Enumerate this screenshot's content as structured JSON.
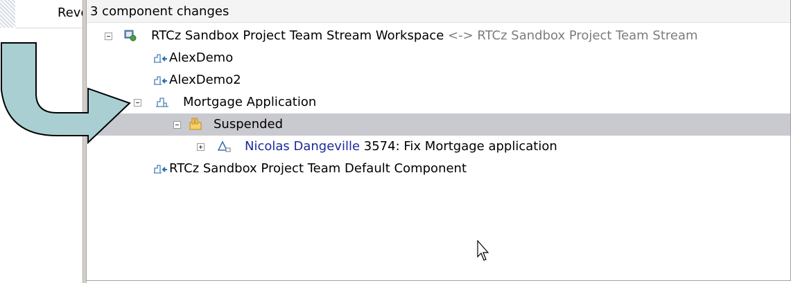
{
  "left_tab": {
    "label": "Revers"
  },
  "view": {
    "header": "3 component changes"
  },
  "tree": {
    "workspace": {
      "name": "RTCz Sandbox Project Team Stream Workspace",
      "separator": "<->",
      "target": "RTCz Sandbox Project Team Stream"
    },
    "components": [
      {
        "label": "AlexDemo"
      },
      {
        "label": "AlexDemo2"
      },
      {
        "label": "Mortgage Application"
      },
      {
        "label": "RTCz Sandbox Project Team Default Component"
      }
    ],
    "suspended": {
      "label": "Suspended"
    },
    "change_set": {
      "author": "Nicolas Dangeville",
      "description": "3574: Fix Mortgage application"
    }
  },
  "colors": {
    "selection": "#c9c9d0",
    "author_link": "#1b2a9a",
    "arrow_fill": "#a9cfd2"
  }
}
